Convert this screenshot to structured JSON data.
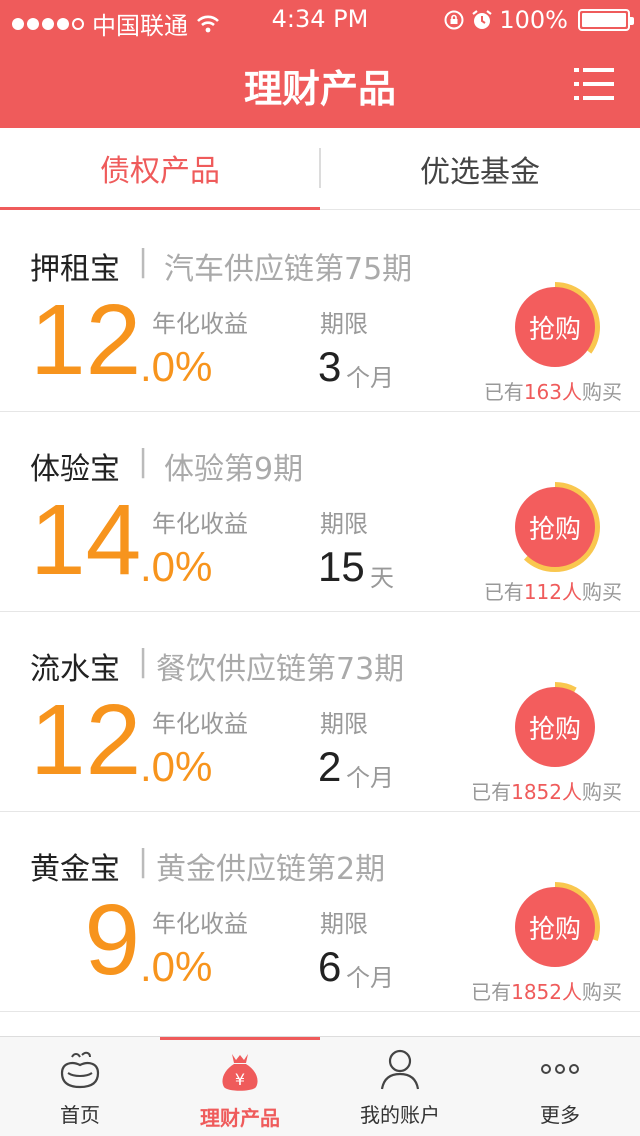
{
  "status_bar": {
    "carrier": "中国联通",
    "time": "4:34 PM",
    "battery": "100%"
  },
  "nav": {
    "title": "理财产品",
    "menu_icon": "menu-icon"
  },
  "tabs": [
    {
      "label": "债权产品",
      "active": true
    },
    {
      "label": "优选基金",
      "active": false
    }
  ],
  "products": [
    {
      "name": "押租宝",
      "separator": "|",
      "subtitle": "汽车供应链第75期",
      "rate_int": "12",
      "rate_dec": ".0%",
      "rate_label": "年化收益",
      "term_label": "期限",
      "term_value": "3",
      "term_unit": "个月",
      "buy_label": "抢购",
      "buyers_prefix": "已有",
      "buyers_count": "163人",
      "buyers_suffix": "购买",
      "progress": 0.35
    },
    {
      "name": "体验宝",
      "separator": "|",
      "subtitle": "体验第9期",
      "rate_int": "14",
      "rate_dec": ".0%",
      "rate_label": "年化收益",
      "term_label": "期限",
      "term_value": "15",
      "term_unit": "天",
      "buy_label": "抢购",
      "buyers_prefix": "已有",
      "buyers_count": "112人",
      "buyers_suffix": "购买",
      "progress": 0.62
    },
    {
      "name": "流水宝",
      "separator": "|",
      "subtitle": "餐饮供应链第73期",
      "rate_int": "12",
      "rate_dec": ".0%",
      "rate_label": "年化收益",
      "term_label": "期限",
      "term_value": "2",
      "term_unit": "个月",
      "buy_label": "抢购",
      "buyers_prefix": "已有",
      "buyers_count": "1852人",
      "buyers_suffix": "购买",
      "progress": 0.08
    },
    {
      "name": "黄金宝",
      "separator": "|",
      "subtitle": "黄金供应链第2期",
      "rate_int": "9",
      "rate_dec": ".0%",
      "rate_label": "年化收益",
      "term_label": "期限",
      "term_value": "6",
      "term_unit": "个月",
      "buy_label": "抢购",
      "buyers_prefix": "已有",
      "buyers_count": "1852人",
      "buyers_suffix": "购买",
      "progress": 0.3
    }
  ],
  "tabbar": [
    {
      "label": "首页",
      "icon": "home-icon",
      "active": false
    },
    {
      "label": "理财产品",
      "icon": "money-bag-icon",
      "active": true
    },
    {
      "label": "我的账户",
      "icon": "user-icon",
      "active": false
    },
    {
      "label": "更多",
      "icon": "more-icon",
      "active": false
    }
  ],
  "colors": {
    "brand": "#ef5b5b",
    "rate": "#f7941d",
    "ring": "#f9c74f"
  }
}
